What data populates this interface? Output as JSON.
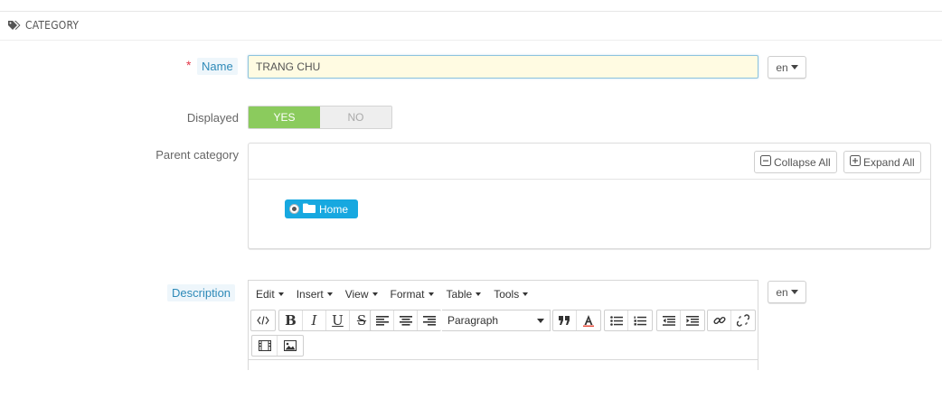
{
  "panel": {
    "title": "CATEGORY",
    "icon": "tags-icon"
  },
  "name_field": {
    "label": "Name",
    "required_mark": "*",
    "value": "TRANG CHU",
    "lang": "en"
  },
  "displayed": {
    "label": "Displayed",
    "yes": "YES",
    "no": "NO",
    "selected": "YES"
  },
  "parent_category": {
    "label": "Parent category",
    "collapse_label": "Collapse All",
    "expand_label": "Expand All",
    "tree": [
      {
        "label": "Home",
        "selected": true
      }
    ]
  },
  "description": {
    "label": "Description",
    "lang": "en",
    "menus": [
      "Edit",
      "Insert",
      "View",
      "Format",
      "Table",
      "Tools"
    ],
    "format_select": "Paragraph"
  },
  "colors": {
    "accent": "#17a8e0",
    "yes": "#8bcb5d",
    "required": "#e2384a",
    "input_bg": "#fffbe2"
  }
}
